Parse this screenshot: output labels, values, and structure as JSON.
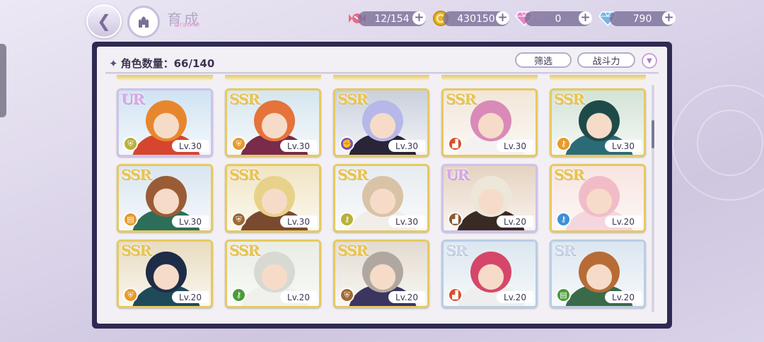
{
  "header": {
    "title": "育成",
    "title_script": "Growth",
    "back_icon": "back-arrow-icon",
    "home_icon": "castle-icon"
  },
  "resources": [
    {
      "name": "candy",
      "icon": "candy-icon",
      "value": "12/154",
      "color": "#e96a86"
    },
    {
      "name": "gold",
      "icon": "coin-icon",
      "value": "430150",
      "color": "#e8b62a"
    },
    {
      "name": "gem-pink",
      "icon": "pink-diamond-icon",
      "value": "0",
      "color": "#e683c9"
    },
    {
      "name": "gem-blue",
      "icon": "blue-diamond-icon",
      "value": "790",
      "color": "#74b5e8"
    }
  ],
  "panel": {
    "count_label": "角色数量：",
    "count_value": "66/140",
    "filter_label": "筛选",
    "sort_label": "战斗力",
    "sort_toggle_icon": "chevron-down-icon"
  },
  "cards": [
    {
      "rarity": "UR",
      "level": "Lv.30",
      "attr_icon": "shield-icon",
      "attr_color": "#b8b23a",
      "hair": "#e8862e",
      "bg": "#cfe3f2",
      "outfit": "#d6452f"
    },
    {
      "rarity": "SSR",
      "level": "Lv.30",
      "attr_icon": "shield-icon",
      "attr_color": "#e79a2b",
      "hair": "#e5733a",
      "bg": "#d5e6ee",
      "outfit": "#7a2a4a"
    },
    {
      "rarity": "SSR",
      "level": "Lv.30",
      "attr_icon": "fist-icon",
      "attr_color": "#7d55b8",
      "hair": "#b5b8e8",
      "bg": "#c9d0dc",
      "outfit": "#2a2438"
    },
    {
      "rarity": "SSR",
      "level": "Lv.30",
      "attr_icon": "boot-icon",
      "attr_color": "#d9502f",
      "hair": "#d98ab8",
      "bg": "#f1e6d8",
      "outfit": "#f4f1f2"
    },
    {
      "rarity": "SSR",
      "level": "Lv.30",
      "attr_icon": "key-icon",
      "attr_color": "#e79a2b",
      "hair": "#1f4a4a",
      "bg": "#d3e3d6",
      "outfit": "#2b6b78"
    },
    {
      "rarity": "SSR",
      "level": "Lv.30",
      "attr_icon": "book-icon",
      "attr_color": "#e79a2b",
      "hair": "#9a5c36",
      "bg": "#d8e5f0",
      "outfit": "#2d6e5a"
    },
    {
      "rarity": "SSR",
      "level": "Lv.30",
      "attr_icon": "shield-icon",
      "attr_color": "#a06a35",
      "hair": "#e8d28a",
      "bg": "#f0e4c2",
      "outfit": "#7a4a30"
    },
    {
      "rarity": "SSR",
      "level": "Lv.30",
      "attr_icon": "key-icon",
      "attr_color": "#b8b23a",
      "hair": "#d8c3a6",
      "bg": "#e7ecf0",
      "outfit": "#f1eeea"
    },
    {
      "rarity": "UR",
      "level": "Lv.20",
      "attr_icon": "boot-icon",
      "attr_color": "#8c5a35",
      "hair": "#ede7da",
      "bg": "#e5d2c0",
      "outfit": "#3a2a24"
    },
    {
      "rarity": "SSR",
      "level": "Lv.20",
      "attr_icon": "key-icon",
      "attr_color": "#3d8fd6",
      "hair": "#f1bcc8",
      "bg": "#f7e4df",
      "outfit": "#f4d6df"
    },
    {
      "rarity": "SSR",
      "level": "Lv.20",
      "attr_icon": "shield-icon",
      "attr_color": "#e79a2b",
      "hair": "#1e2c48",
      "bg": "#e8dcc0",
      "outfit": "#1f4a5a"
    },
    {
      "rarity": "SSR",
      "level": "Lv.20",
      "attr_icon": "key-icon",
      "attr_color": "#4a9b3a",
      "hair": "#d9d9d4",
      "bg": "#e8ede4",
      "outfit": "#f0f0ec"
    },
    {
      "rarity": "SSR",
      "level": "Lv.20",
      "attr_icon": "shield-icon",
      "attr_color": "#a06a35",
      "hair": "#b0a8a0",
      "bg": "#e3dbd0",
      "outfit": "#3b3560"
    },
    {
      "rarity": "SR",
      "level": "Lv.20",
      "attr_icon": "boot-icon",
      "attr_color": "#d9502f",
      "hair": "#d6466a",
      "bg": "#dbe7ef",
      "outfit": "#eeeeee"
    },
    {
      "rarity": "SR",
      "level": "Lv.20",
      "attr_icon": "book-icon",
      "attr_color": "#4a9b3a",
      "hair": "#b86b35",
      "bg": "#dbe6f0",
      "outfit": "#3a6a4a"
    }
  ]
}
